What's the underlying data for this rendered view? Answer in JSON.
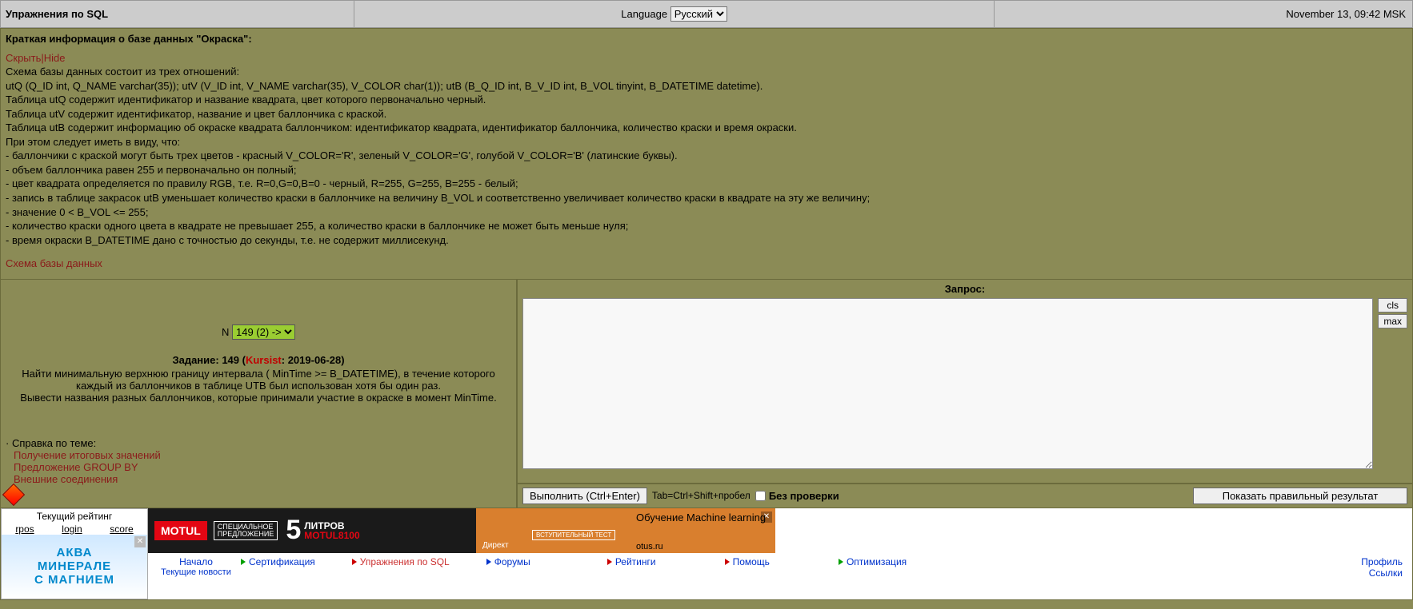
{
  "top": {
    "title": "Упражнения по SQL",
    "lang_label": "Language",
    "lang_value": "Русский",
    "datetime": "November 13, 09:42 MSK"
  },
  "info": {
    "title": "Краткая информация о базе данных \"Окраска\":",
    "hide": "Скрыть|Hide",
    "body": "Схема базы данных состоит из трех отношений:\nutQ (Q_ID int, Q_NAME varchar(35)); utV (V_ID int, V_NAME varchar(35), V_COLOR char(1)); utB (B_Q_ID int, B_V_ID int, B_VOL tinyint, B_DATETIME datetime).\nТаблица utQ содержит идентификатор и название квадрата, цвет которого первоначально черный.\nТаблица utV содержит идентификатор, название и цвет баллончика с краской.\nТаблица utB содержит информацию об окраске квадрата баллончиком: идентификатор квадрата, идентификатор баллончика, количество краски и время окраски.\nПри этом следует иметь в виду, что:\n- баллончики с краской могут быть трех цветов - красный V_COLOR='R', зеленый V_COLOR='G', голубой V_COLOR='B' (латинские буквы).\n- объем баллончика равен 255 и первоначально он полный;\n- цвет квадрата определяется по правилу RGB, т.е. R=0,G=0,B=0 - черный, R=255, G=255, B=255 - белый;\n- запись в таблице закрасок utB уменьшает количество краски в баллончике на величину B_VOL и соответственно увеличивает количество краски в квадрате на эту же величину;\n- значение 0 < B_VOL <= 255;\n- количество краски одного цвета в квадрате не превышает 255, а количество краски в баллончике не может быть меньше нуля;\n- время окраски B_DATETIME дано с точностью до секунды, т.е. не содержит миллисекунд.",
    "schema": "Схема базы данных"
  },
  "task": {
    "n_label": "N",
    "n_value": "149 (2) ->",
    "title_prefix": "Задание: 149 (",
    "author": "Kursist",
    "title_suffix": ": 2019-06-28)",
    "text": "Найти минимальную верхнюю границу интервала ( MinTime >= B_DATETIME), в течение которого каждый из баллончиков в таблице UTB был использован хотя бы один раз.\nВывести названия разных баллончиков, которые принимали участие в окраске в момент MinTime.",
    "help_label": "Справка по теме:",
    "help_links": [
      "Получение итоговых значений",
      "Предложение GROUP BY",
      "Внешние соединения"
    ]
  },
  "query": {
    "head": "Запрос:",
    "cls": "cls",
    "max": "max",
    "run": "Выполнить (Ctrl+Enter)",
    "hint": "Tab=Ctrl+Shift+пробел",
    "nocheck": "Без  проверки",
    "show": "Показать правильный результат"
  },
  "rating": {
    "title": "Текущий рейтинг",
    "cols": [
      "rpos",
      "login",
      "score"
    ]
  },
  "ad1": {
    "line1": "АКВА",
    "line2": "МИНЕРАЛЕ",
    "line3": "С МАГНИЕМ"
  },
  "banner1": {
    "brand": "MOTUL",
    "spec": "СПЕЦИАЛЬНОЕ\nПРЕДЛОЖЕНИЕ",
    "big": "5",
    "litrov": "ЛИТРОВ",
    "prod": "MOTUL8100"
  },
  "banner2": {
    "title": "Обучение Machine learning",
    "direct": "Директ",
    "test": "ВСТУПИТЕЛЬНЫЙ ТЕСТ",
    "otus": "otus.ru"
  },
  "nav": {
    "home": "Начало",
    "home_sub": "Текущие новости",
    "cert": "Сертификация",
    "sql": "Упражнения по SQL",
    "forums": "Форумы",
    "ratings": "Рейтинги",
    "help": "Помощь",
    "opt": "Оптимизация",
    "profile": "Профиль",
    "links": "Ссылки"
  }
}
